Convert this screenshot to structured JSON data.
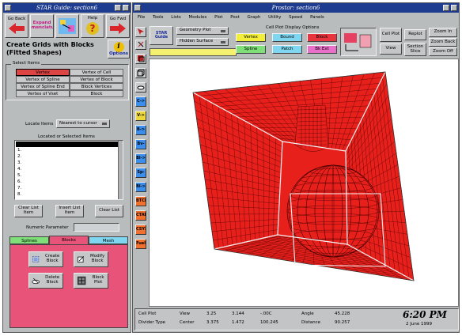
{
  "left_window": {
    "title": "STAR Guide: section6",
    "toolbar": [
      "Go Back",
      "Expand Nomenclature",
      "Guide Me",
      "Help",
      "Go Fwd"
    ],
    "heading_line1": "Create Grids with Blocks",
    "heading_line2": "(Fitted Shapes)",
    "options_label": "Options",
    "options_icon_text": "i",
    "select_items_label": "Select Items",
    "select_items": [
      "Vertex",
      "Vertex of Cell",
      "Vertex of Spline",
      "Vertex of Block",
      "Vertex of Spline End",
      "Block Vertices",
      "Vertex of Vset",
      "Block"
    ],
    "locate_label": "Locate Items",
    "locate_value": "Nearest to cursor",
    "located_label": "Located or Selected Items",
    "list_rows": [
      "1.",
      "2.",
      "3.",
      "4.",
      "5.",
      "6.",
      "7.",
      "8."
    ],
    "list_buttons": [
      "Clear List Item",
      "Insert List Item",
      "Clear List"
    ],
    "numeric_label": "Numeric Parameter",
    "numeric_value": "",
    "tabs": [
      "Splines",
      "Blocks",
      "Mesh"
    ],
    "block_buttons": [
      "Create Block",
      "Modify Block",
      "Delete Block",
      "Block Plot"
    ]
  },
  "main_window": {
    "title": "Prostar: section6",
    "menu": [
      "File",
      "Tools",
      "Lists",
      "Modules",
      "Plot",
      "Post",
      "Graph",
      "Utility",
      "Speed",
      "Panels"
    ],
    "star_label_line1": "STAR",
    "star_label_line2": "Guide",
    "geometry_dropdown": "Geometry Plot",
    "surface_dropdown": "Hidden Surface",
    "display_options_label": "Cell Plot Display Options",
    "display_buttons": [
      {
        "label": "Vertex",
        "color": "#f2ee3a"
      },
      {
        "label": "Bound",
        "color": "#7fd6f0"
      },
      {
        "label": "Block",
        "color": "#e8343c"
      },
      {
        "label": "Spline",
        "color": "#7fe07a"
      },
      {
        "label": "Patch",
        "color": "#7fd6f0"
      },
      {
        "label": "Bk Ext",
        "color": "#e870c8"
      }
    ],
    "plot_buttons": [
      "Cell Plot",
      "Replot",
      "Zoom In",
      "View",
      "Section Slice",
      "Zoom Back",
      "Zoom Off"
    ],
    "side_tools": [
      {
        "label": "C->",
        "color": "#3d8dea"
      },
      {
        "label": "V->",
        "color": "#ecd83a"
      },
      {
        "label": "B->",
        "color": "#3d8dea"
      },
      {
        "label": "Bv->",
        "color": "#3d8dea"
      },
      {
        "label": "Bl->",
        "color": "#3d8dea"
      },
      {
        "label": "Sp->",
        "color": "#3d8dea"
      },
      {
        "label": "Bl->",
        "color": "#3d8dea"
      },
      {
        "label": "BTCH",
        "color": "#f07030"
      },
      {
        "label": "CTAB",
        "color": "#f07030"
      },
      {
        "label": "CSYS",
        "color": "#f07030"
      },
      {
        "label": "Fuel",
        "color": "#f07030"
      }
    ],
    "status": {
      "row1_label": "Cell Plot",
      "row2_label": "Divider Type",
      "view_label": "View",
      "center_label": "Center",
      "view_values": [
        "3.25",
        "3.144",
        "-.00C"
      ],
      "center_values": [
        "3.375",
        "1.472",
        "100.245"
      ],
      "angle_label": "Angle",
      "angle_value": "45.228",
      "distance_label": "Distance",
      "distance_value": "90.257",
      "time": "6:20 PM",
      "date": "2 June 1999"
    },
    "mesh_color": "#e8201c"
  }
}
